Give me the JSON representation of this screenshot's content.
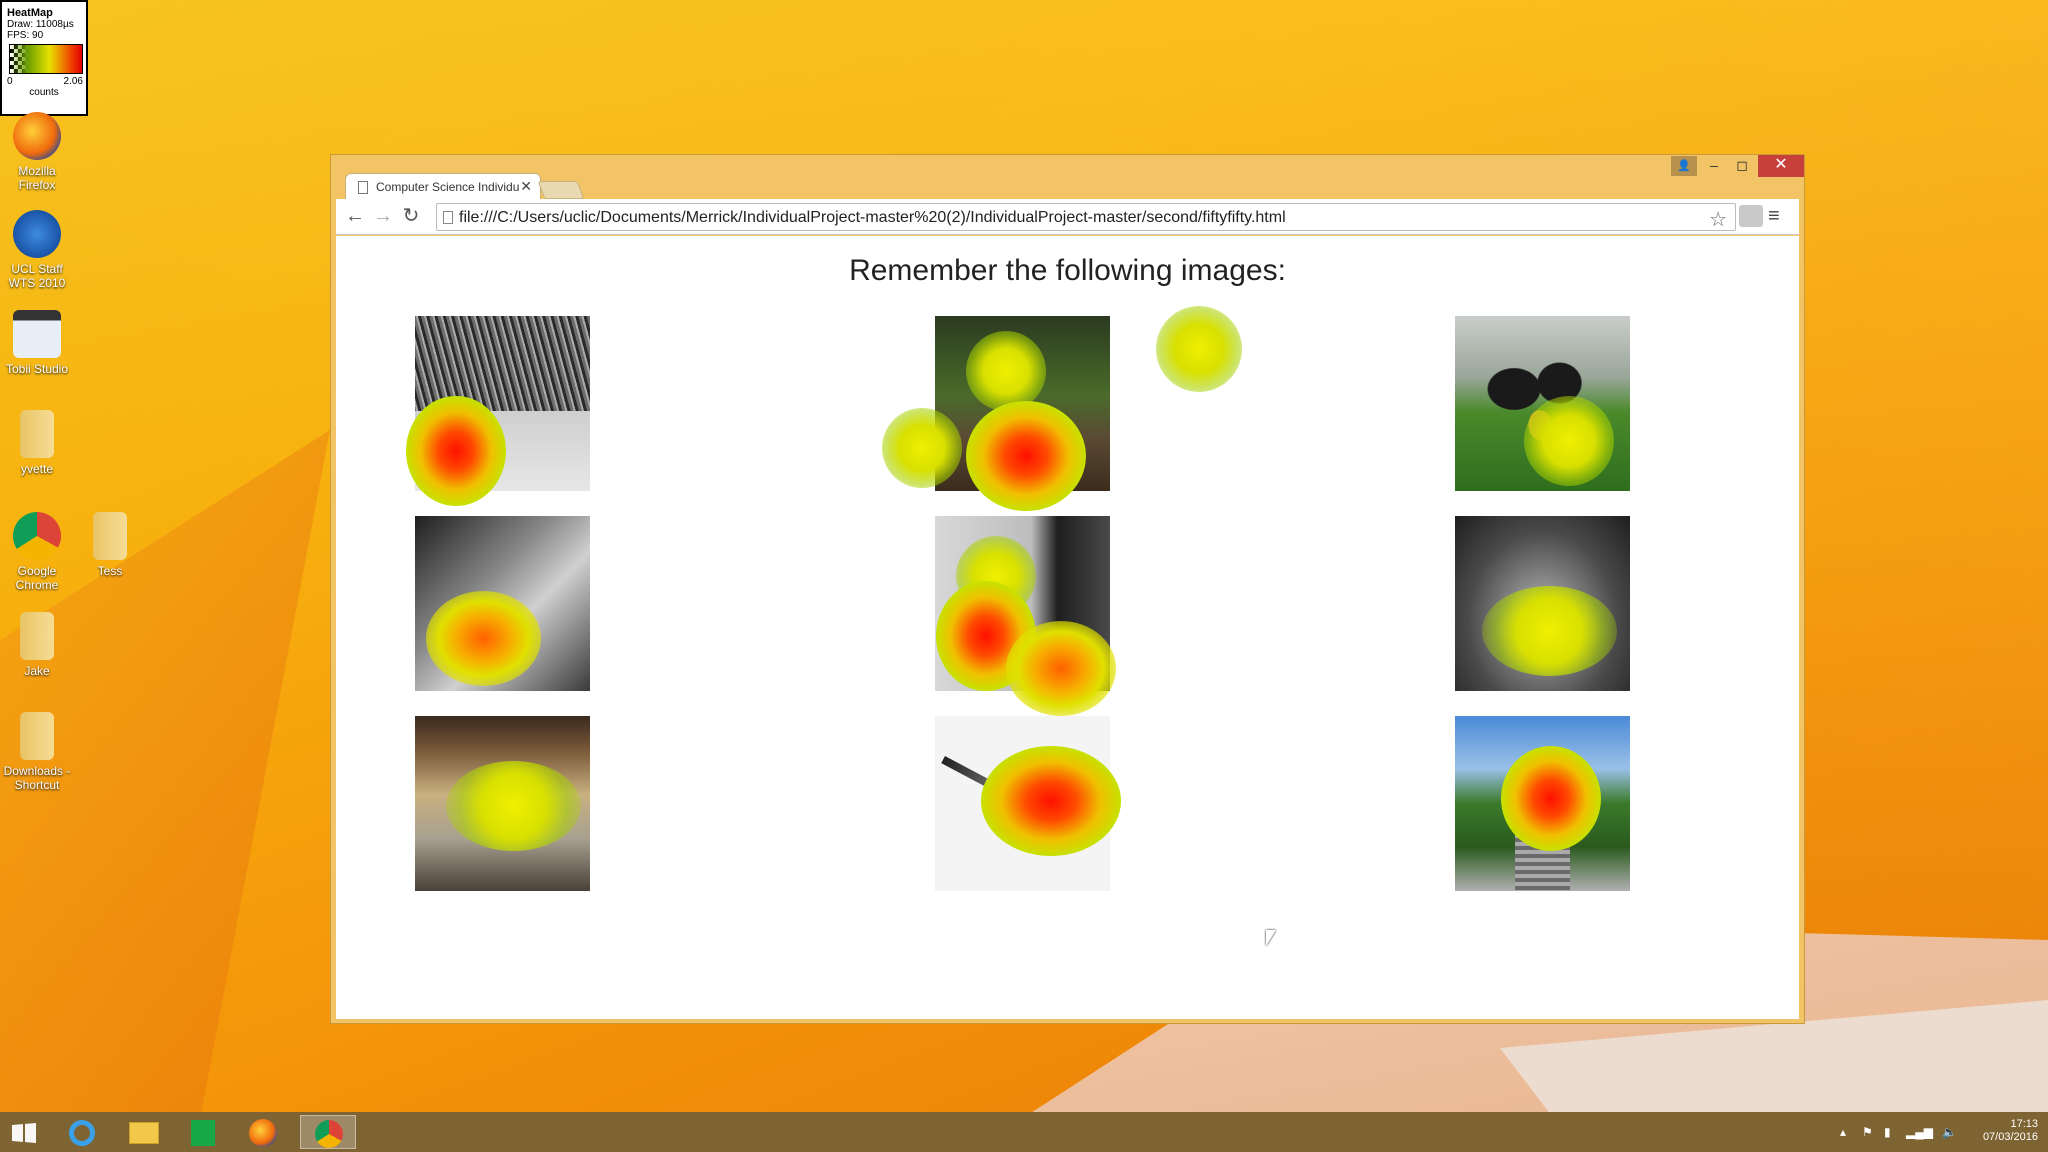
{
  "heatmap_legend": {
    "title": "HeatMap",
    "draw": "Draw: 11008µs",
    "fps": "FPS: 90",
    "min": "0",
    "max": "2.06",
    "unit": "counts"
  },
  "desktop_icons": [
    "Mozilla Firefox",
    "UCL Staff WTS 2010",
    "Tobii Studio",
    "yvette",
    "Google Chrome",
    "Tess",
    "Jake",
    "Downloads - Shortcut"
  ],
  "browser": {
    "tab_title": "Computer Science Individu",
    "url": "file:///C:/Users/uclic/Documents/Merrick/IndividualProject-master%20(2)/IndividualProject-master/second/fiftyfifty.html"
  },
  "page": {
    "heading": "Remember the following images:"
  },
  "images": [
    "forest-bw",
    "forest-path",
    "rugby-players",
    "dishwasher-bw",
    "building-bw",
    "plants-bw",
    "perfume-bottle",
    "pen",
    "park-stairs"
  ],
  "taskbar": {
    "time": "17:13",
    "date": "07/03/2016"
  },
  "colors": {
    "desktop": "#f6b10f",
    "close": "#c7403a",
    "taskbar": "#7e6333"
  }
}
